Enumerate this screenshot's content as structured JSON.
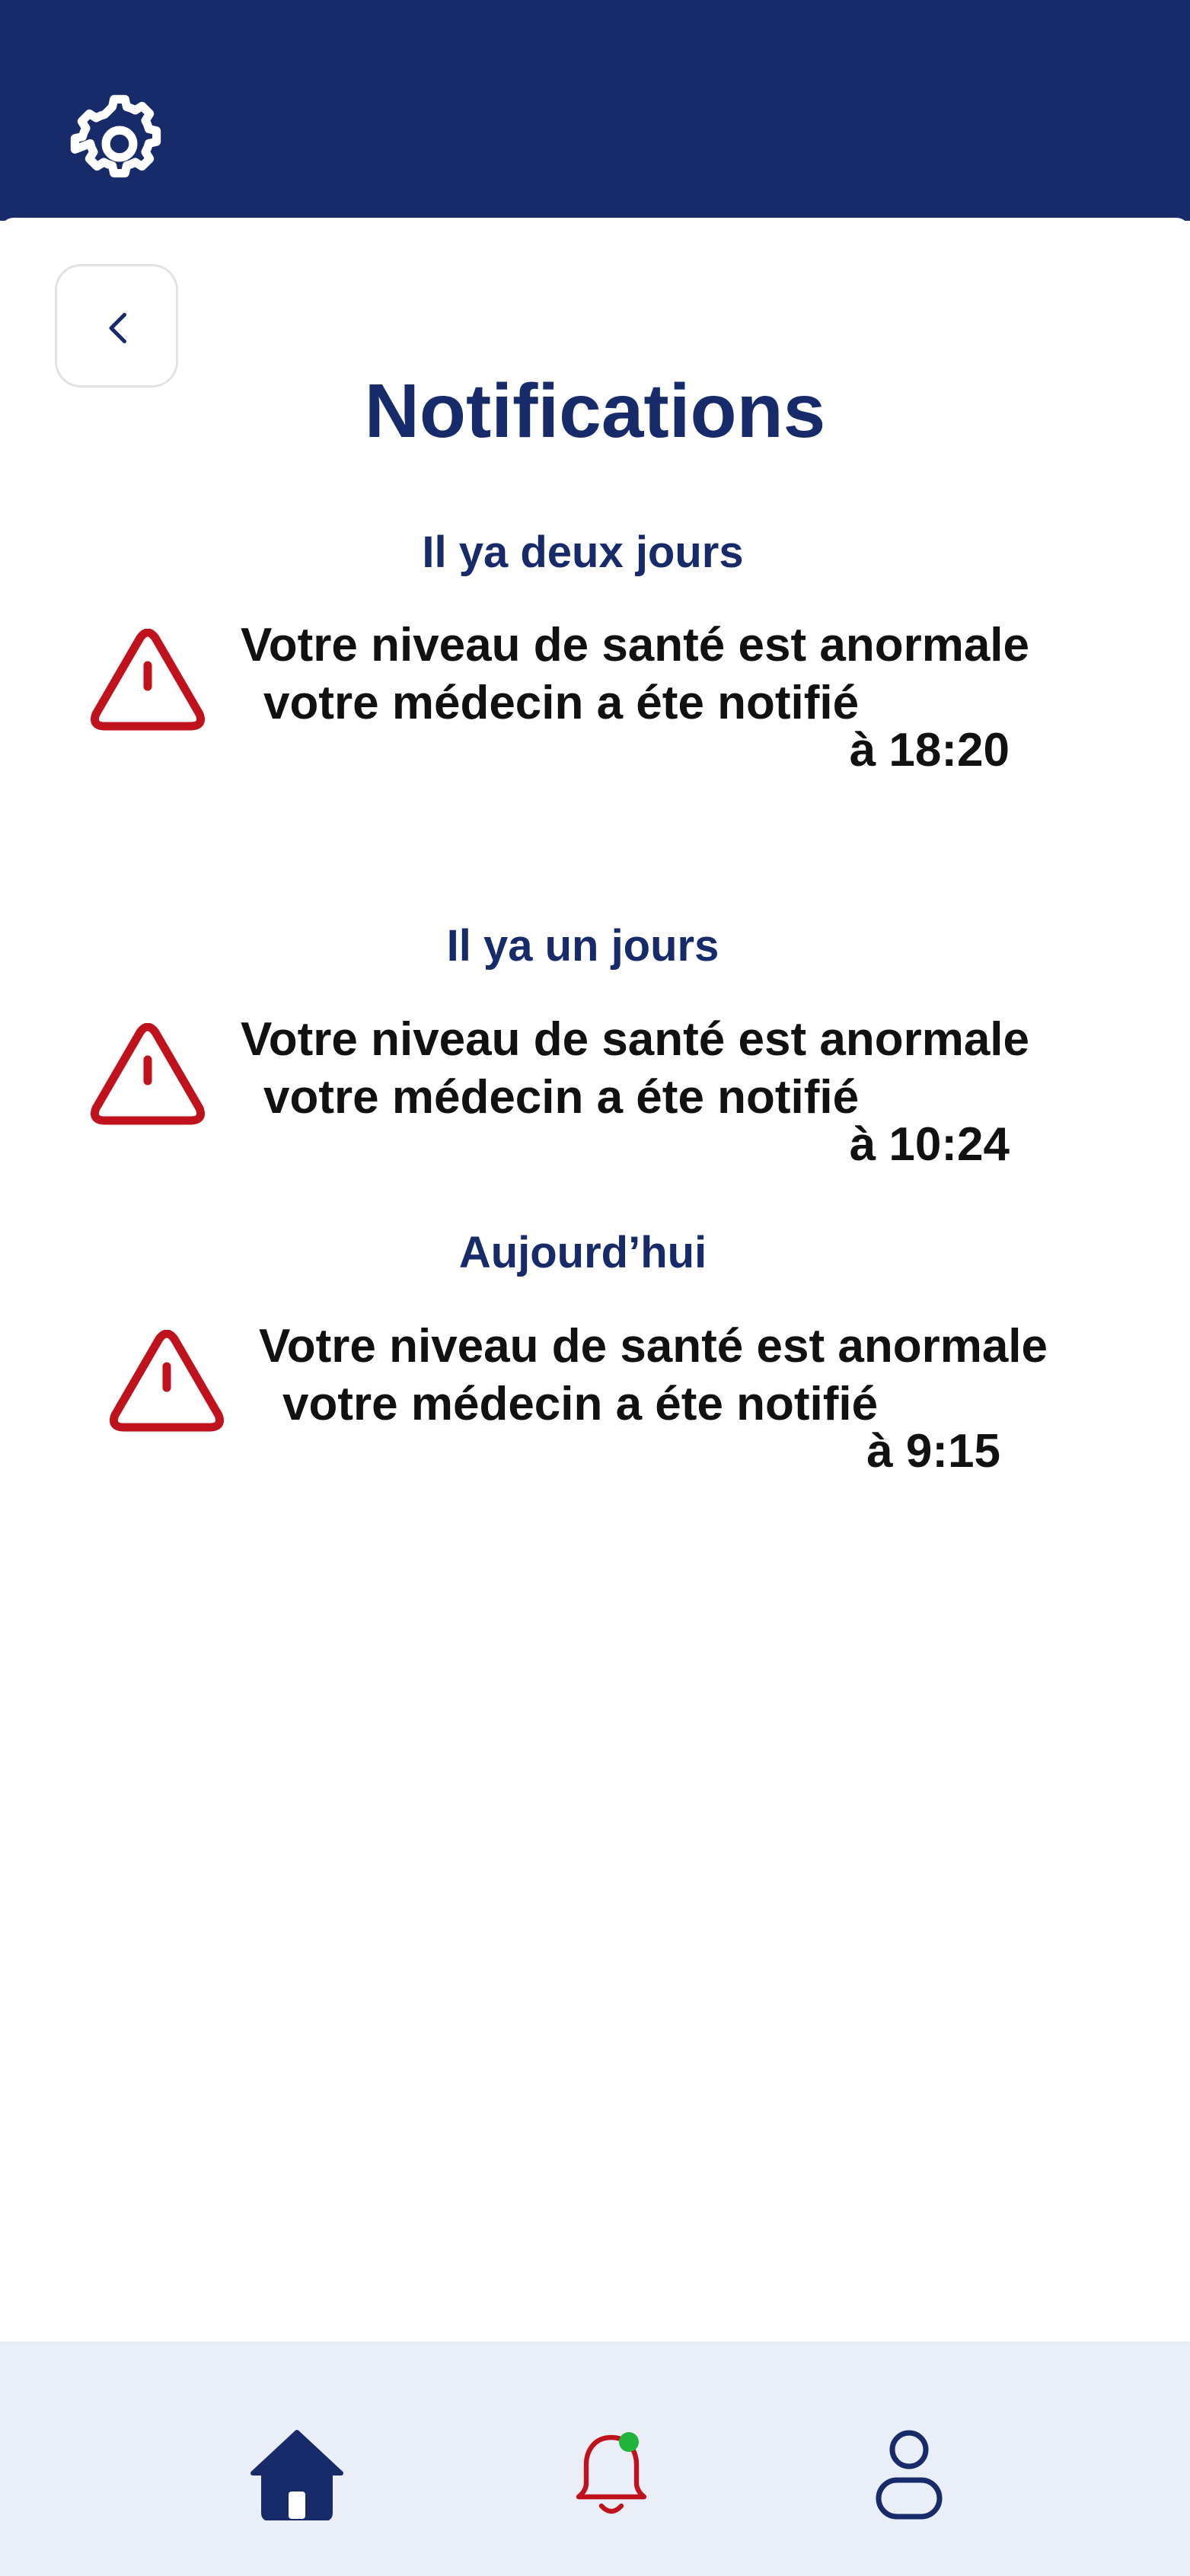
{
  "header": {
    "settings_icon": "gear-icon",
    "bg_color": "#172a6a"
  },
  "back_icon": "chevron-left-icon",
  "title": "Notifications",
  "notification_groups": [
    {
      "label": "Il ya deux jours",
      "items": [
        {
          "icon": "warning-triangle-icon",
          "line1": "Votre niveau de santé est anormale",
          "line2": "votre médecin a éte notifié",
          "time": "à 18:20"
        }
      ]
    },
    {
      "label": "Il ya un jours",
      "items": [
        {
          "icon": "warning-triangle-icon",
          "line1": "Votre niveau de santé est anormale",
          "line2": "votre médecin a éte notifié",
          "time": "à 10:24"
        }
      ]
    },
    {
      "label": "Aujourd’hui",
      "items": [
        {
          "icon": "warning-triangle-icon",
          "line1": "Votre niveau de santé est anormale",
          "line2": "votre médecin a éte notifié",
          "time": "à 9:15"
        }
      ]
    }
  ],
  "bottom_nav": {
    "items": [
      {
        "icon": "home-icon"
      },
      {
        "icon": "bell-icon",
        "badge": "green-dot"
      },
      {
        "icon": "user-icon"
      }
    ]
  },
  "colors": {
    "primary": "#172a6a",
    "alert": "#c0121c",
    "badge": "#22b33a",
    "nav_bg": "#e9eef7"
  }
}
